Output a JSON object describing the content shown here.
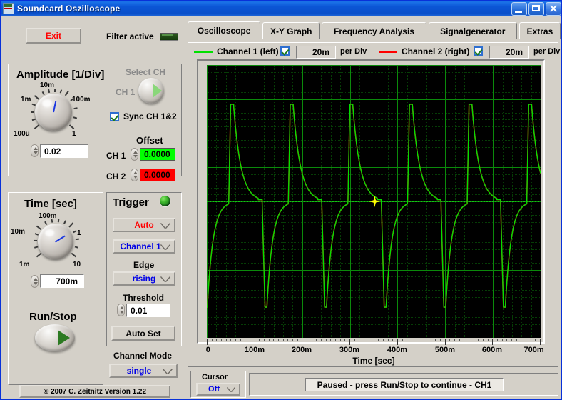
{
  "window": {
    "title": "Soundcard Oszilloscope",
    "buttons": {
      "minimize": "minimize",
      "maximize": "maximize",
      "close": "close"
    }
  },
  "toolbar": {
    "exit_label": "Exit",
    "filter_label": "Filter active"
  },
  "amplitude": {
    "title": "Amplitude [1/Div]",
    "knob_labels": [
      "100u",
      "1m",
      "10m",
      "100m",
      "1"
    ],
    "value": "0.02",
    "select_ch_label": "Select CH",
    "ch_label": "CH 1",
    "sync_label": "Sync CH 1&2",
    "sync_checked": true,
    "offset_title": "Offset",
    "offset_ch1_label": "CH 1",
    "offset_ch1_value": "0.0000",
    "offset_ch1_color": "#00ff00",
    "offset_ch2_label": "CH 2",
    "offset_ch2_value": "0.0000",
    "offset_ch2_color": "#ff0000"
  },
  "time": {
    "title": "Time [sec]",
    "knob_labels": [
      "1m",
      "10m",
      "100m",
      "1",
      "10"
    ],
    "value": "700m",
    "runstop_label": "Run/Stop"
  },
  "trigger": {
    "title": "Trigger",
    "mode": "Auto",
    "channel": "Channel 1",
    "edge_label": "Edge",
    "edge": "rising",
    "threshold_label": "Threshold",
    "threshold": "0.01",
    "autoset_label": "Auto Set",
    "channel_mode_label": "Channel Mode",
    "channel_mode": "single"
  },
  "footer": {
    "copyright": "© 2007   C. Zeitnitz Version 1.22"
  },
  "tabs": [
    {
      "label": "Oscilloscope",
      "active": true
    },
    {
      "label": "X-Y Graph",
      "active": false
    },
    {
      "label": "Frequency Analysis",
      "active": false
    },
    {
      "label": "Signalgenerator",
      "active": false
    },
    {
      "label": "Extras",
      "active": false
    }
  ],
  "channels": [
    {
      "label": "Channel 1 (left)",
      "color": "#00e000",
      "enabled": true,
      "per_div": "20m",
      "per_div_label": "per Div"
    },
    {
      "label": "Channel 2 (right)",
      "color": "#ff0000",
      "enabled": true,
      "per_div": "20m",
      "per_div_label": "per Div"
    }
  ],
  "cursor": {
    "label": "Cursor",
    "value": "Off"
  },
  "status": {
    "message": "Paused - press Run/Stop to continue - CH1"
  },
  "chart_data": {
    "type": "line",
    "title": "",
    "xlabel": "Time [sec]",
    "ylabel": "",
    "xlim": [
      0,
      0.7
    ],
    "ylim": [
      -0.08,
      0.08
    ],
    "xticks": [
      0,
      0.1,
      0.2,
      0.3,
      0.4,
      0.5,
      0.6,
      0.7
    ],
    "xticklabels": [
      "0",
      "100m",
      "200m",
      "300m",
      "400m",
      "500m",
      "600m",
      "700m"
    ],
    "grid": true,
    "grid_major_color": "#0b8a0b",
    "grid_minor_color": "#063d06",
    "background": "#000000",
    "divisions_x": 7,
    "divisions_y": 8,
    "volts_per_div": 0.02,
    "cursor_marker": {
      "x": 0.352,
      "y": 0.0,
      "color": "#ffff00"
    },
    "series": [
      {
        "name": "Channel 1 (left)",
        "color": "#00e000",
        "description": "sawtooth-like pulse train: sharp positive spike, exponential decay to baseline, sharp negative undershoot, recovery",
        "period": 0.125,
        "spike_times": [
          0.046,
          0.171,
          0.296,
          0.418,
          0.543,
          0.668
        ],
        "peak_value": 0.057,
        "trough_value": -0.062
      },
      {
        "name": "Channel 2 (right)",
        "color": "#ff0000",
        "description": "overlaid nearly identical trace, mostly hidden behind channel 1",
        "period": 0.125,
        "spike_times": [
          0.046,
          0.171,
          0.296,
          0.418,
          0.543,
          0.668
        ],
        "peak_value": 0.057,
        "trough_value": -0.062
      }
    ]
  }
}
